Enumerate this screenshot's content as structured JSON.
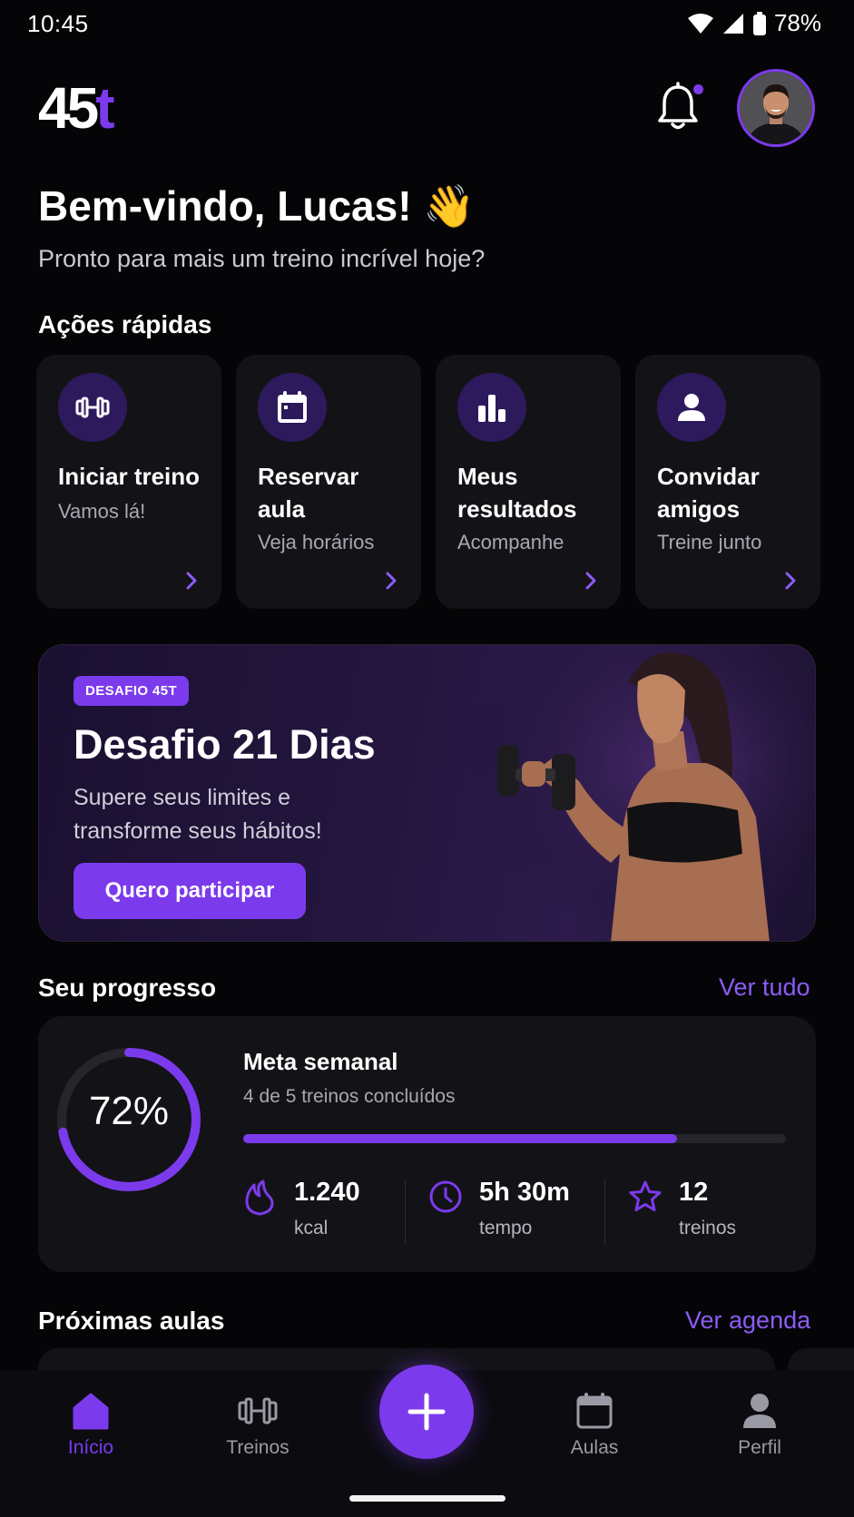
{
  "status_bar": {
    "time": "10:45",
    "battery": "78%"
  },
  "header": {
    "logo_main": "45",
    "logo_accent": "t"
  },
  "greeting": {
    "title": "Bem-vindo, Lucas! 👋",
    "subtitle": "Pronto para mais um treino incrível hoje?"
  },
  "quick_actions": {
    "title": "Ações rápidas",
    "items": [
      {
        "title": "Iniciar treino",
        "subtitle": "Vamos lá!",
        "icon": "dumbbell-icon"
      },
      {
        "title": "Reservar aula",
        "subtitle": "Veja horários",
        "icon": "calendar-icon"
      },
      {
        "title": "Meus resultados",
        "subtitle": "Acompanhe",
        "icon": "bar-chart-icon"
      },
      {
        "title": "Convidar amigos",
        "subtitle": "Treine junto",
        "icon": "user-icon"
      }
    ]
  },
  "banner": {
    "badge": "DESAFIO 45T",
    "title": "Desafio 21 Dias",
    "subtitle": "Supere seus limites e transforme seus hábitos!",
    "button": "Quero participar"
  },
  "progress": {
    "title": "Seu progresso",
    "link": "Ver tudo",
    "percent_label": "72%",
    "percent": 0.72,
    "goal_title": "Meta semanal",
    "goal_subtitle": "4 de 5 treinos concluídos",
    "goal_fraction": 0.8,
    "stats": [
      {
        "value": "1.240",
        "label": "kcal",
        "icon": "flame-icon"
      },
      {
        "value": "5h 30m",
        "label": "tempo",
        "icon": "clock-icon"
      },
      {
        "value": "12",
        "label": "treinos",
        "icon": "star-icon"
      }
    ]
  },
  "next_classes": {
    "title": "Próximas aulas",
    "link": "Ver agenda"
  },
  "nav": {
    "items": [
      {
        "label": "Início",
        "icon": "home-icon",
        "active": true
      },
      {
        "label": "Treinos",
        "icon": "dumbbell-icon"
      },
      {
        "label": "Aulas",
        "icon": "calendar-icon"
      },
      {
        "label": "Perfil",
        "icon": "user-icon"
      }
    ],
    "fab_icon": "plus-icon"
  },
  "colors": {
    "accent": "#7c3aed",
    "background": "#050507",
    "card": "#131317"
  }
}
